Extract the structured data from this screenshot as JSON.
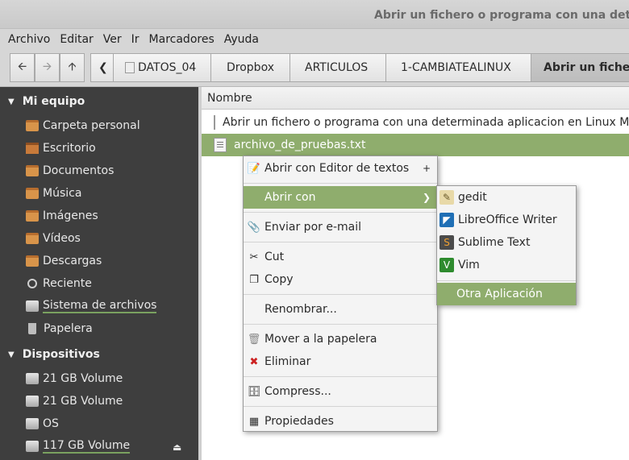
{
  "window": {
    "title": "Abrir un fichero o programa con una dete"
  },
  "menubar": [
    "Archivo",
    "Editar",
    "Ver",
    "Ir",
    "Marcadores",
    "Ayuda"
  ],
  "breadcrumbs": [
    "DATOS_04",
    "Dropbox",
    "ARTICULOS",
    "1-CAMBIATEALINUX",
    "Abrir un fichero"
  ],
  "sidebar": {
    "section1": "Mi equipo",
    "places": [
      "Carpeta personal",
      "Escritorio",
      "Documentos",
      "Música",
      "Imágenes",
      "Vídeos",
      "Descargas",
      "Reciente",
      "Sistema de archivos",
      "Papelera"
    ],
    "section2": "Dispositivos",
    "devices": [
      "21 GB Volume",
      "21 GB Volume",
      "OS",
      "117 GB Volume"
    ]
  },
  "filelist": {
    "column": "Nombre",
    "rows": [
      "Abrir un fichero o programa con una determinada aplicacion en Linux M",
      "archivo_de_pruebas.txt"
    ]
  },
  "context_menu": {
    "open_with_editor": "Abrir con Editor de textos",
    "open_with": "Abrir con",
    "email": "Enviar por e-mail",
    "cut": "Cut",
    "copy": "Copy",
    "rename": "Renombrar...",
    "trash": "Mover a la papelera",
    "delete": "Eliminar",
    "compress": "Compress...",
    "properties": "Propiedades"
  },
  "submenu": [
    "gedit",
    "LibreOffice Writer",
    "Sublime Text",
    "Vim",
    "Otra Aplicación"
  ],
  "colors": {
    "selection": "#8fad6d",
    "sidebar": "#3e3e3e"
  }
}
